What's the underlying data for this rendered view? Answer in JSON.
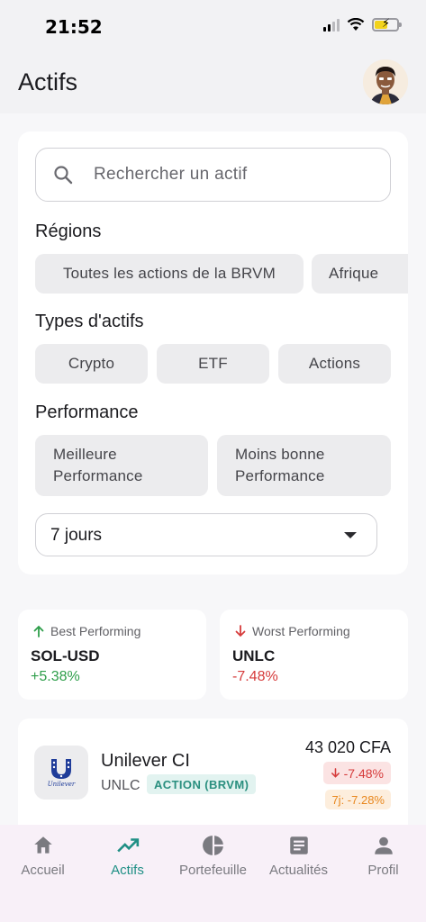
{
  "status_bar": {
    "time": "21:52"
  },
  "header": {
    "title": "Actifs"
  },
  "search": {
    "placeholder": "Rechercher un actif"
  },
  "regions": {
    "label": "Régions",
    "chips": [
      "Toutes les actions de la BRVM",
      "Afrique"
    ]
  },
  "asset_types": {
    "label": "Types d'actifs",
    "chips": [
      "Crypto",
      "ETF",
      "Actions"
    ]
  },
  "performance": {
    "label": "Performance",
    "chips": [
      "Meilleure Performance",
      "Moins bonne Performance"
    ],
    "period_selected": "7 jours"
  },
  "summary": {
    "best": {
      "label": "Best Performing",
      "ticker": "SOL-USD",
      "change": "+5.38%",
      "color": "#2e9e4a"
    },
    "worst": {
      "label": "Worst Performing",
      "ticker": "UNLC",
      "change": "-7.48%",
      "color": "#d63b3b"
    }
  },
  "assets": [
    {
      "name": "Unilever CI",
      "ticker": "UNLC",
      "badge": "ACTION (BRVM)",
      "logo_text": "Unilever",
      "price": "43 020 CFA",
      "change": "-7.48%",
      "change_7d": "7j: -7.28%"
    }
  ],
  "nav": {
    "items": [
      {
        "label": "Accueil",
        "icon": "home-icon"
      },
      {
        "label": "Actifs",
        "icon": "trending-up-icon",
        "active": true
      },
      {
        "label": "Portefeuille",
        "icon": "pie-chart-icon"
      },
      {
        "label": "Actualités",
        "icon": "article-icon"
      },
      {
        "label": "Profil",
        "icon": "person-icon"
      }
    ]
  },
  "colors": {
    "accent": "#1f8f85",
    "positive": "#2e9e4a",
    "negative": "#d63b3b",
    "warning": "#e8871e"
  }
}
